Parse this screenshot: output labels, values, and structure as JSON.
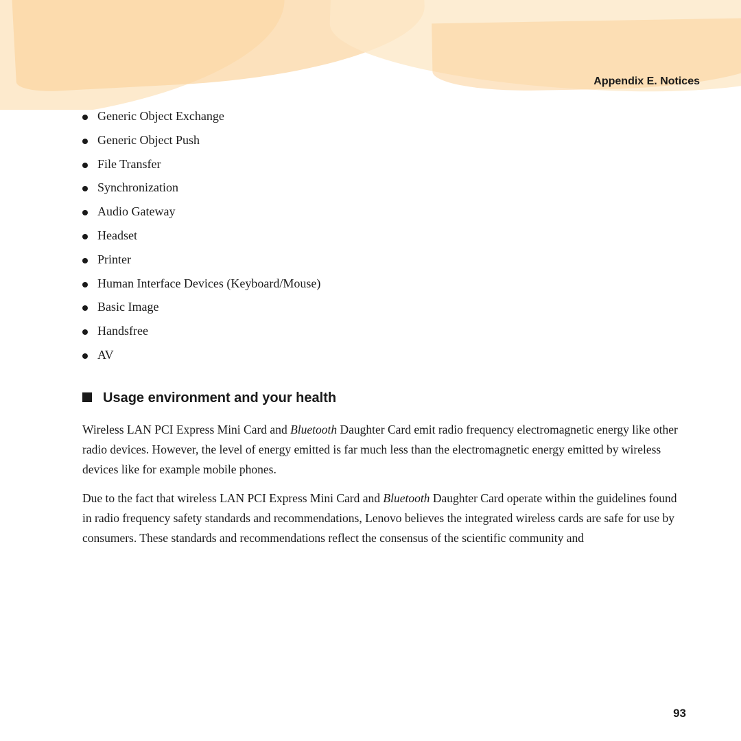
{
  "header": {
    "title": "Appendix E. Notices"
  },
  "bullet_items": [
    "Generic Object Exchange",
    "Generic Object Push",
    "File Transfer",
    "Synchronization",
    "Audio Gateway",
    "Headset",
    "Printer",
    "Human Interface Devices (Keyboard/Mouse)",
    "Basic Image",
    "Handsfree",
    "AV"
  ],
  "section_heading": "Usage environment and your health",
  "paragraphs": [
    {
      "id": "p1",
      "parts": [
        {
          "text": "Wireless LAN PCI Express Mini Card and ",
          "italic": false
        },
        {
          "text": "Bluetooth",
          "italic": true
        },
        {
          "text": " Daughter Card emit radio frequency electromagnetic energy like other radio devices. However, the level of energy emitted is far much less than the electromagnetic energy emitted by wireless devices like for example mobile phones.",
          "italic": false
        }
      ]
    },
    {
      "id": "p2",
      "parts": [
        {
          "text": "Due to the fact that wireless LAN PCI Express Mini Card and ",
          "italic": false
        },
        {
          "text": "Bluetooth",
          "italic": true
        },
        {
          "text": " Daughter Card operate within the guidelines found in radio frequency safety standards and recommendations, Lenovo believes the integrated wireless cards are safe for use by consumers. These standards and recommendations reflect the consensus of the scientific community and",
          "italic": false
        }
      ]
    }
  ],
  "page_number": "93"
}
